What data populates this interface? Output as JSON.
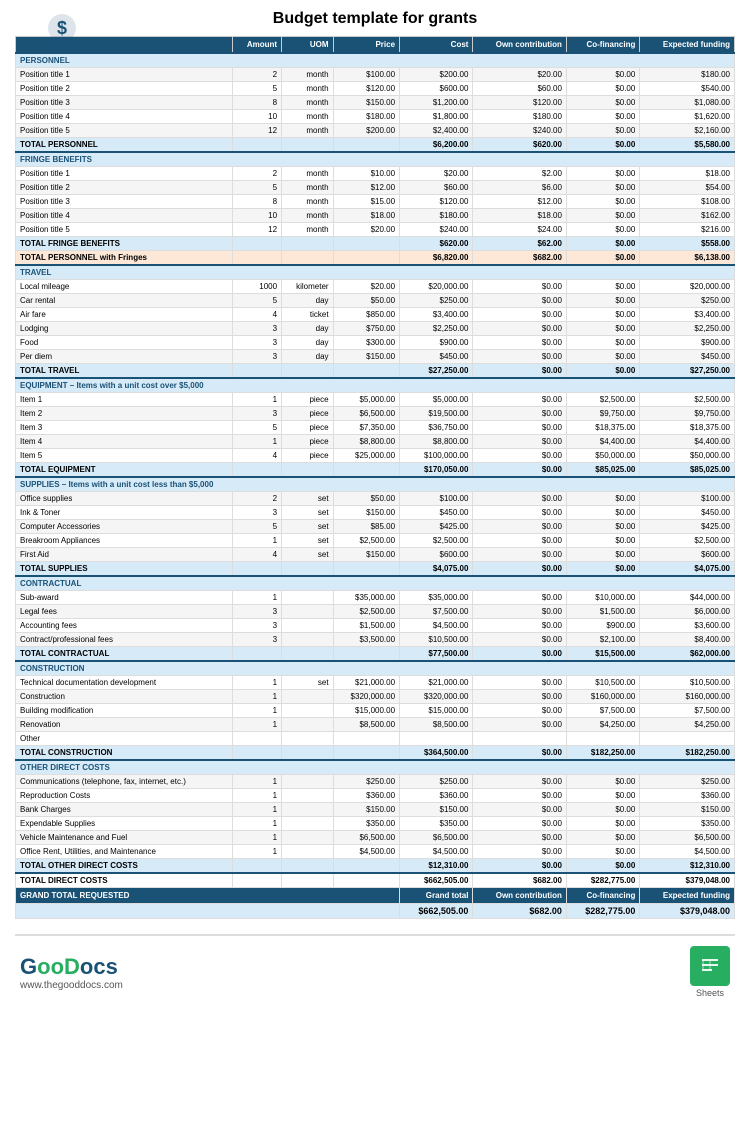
{
  "header": {
    "title": "Budget template for grants"
  },
  "columns": [
    "Amount",
    "UOM",
    "Price",
    "Cost",
    "Own contribution",
    "Co-financing",
    "Expected funding"
  ],
  "sections": [
    {
      "id": "personnel",
      "label": "PERSONNEL",
      "rows": [
        [
          "Position title 1",
          "2",
          "month",
          "$100.00",
          "$200.00",
          "$20.00",
          "$0.00",
          "$180.00"
        ],
        [
          "Position title 2",
          "5",
          "month",
          "$120.00",
          "$600.00",
          "$60.00",
          "$0.00",
          "$540.00"
        ],
        [
          "Position title 3",
          "8",
          "month",
          "$150.00",
          "$1,200.00",
          "$120.00",
          "$0.00",
          "$1,080.00"
        ],
        [
          "Position title 4",
          "10",
          "month",
          "$180.00",
          "$1,800.00",
          "$180.00",
          "$0.00",
          "$1,620.00"
        ],
        [
          "Position title 5",
          "12",
          "month",
          "$200.00",
          "$2,400.00",
          "$240.00",
          "$0.00",
          "$2,160.00"
        ]
      ],
      "total": [
        "TOTAL PERSONNEL",
        "",
        "",
        "",
        "$6,200.00",
        "$620.00",
        "$0.00",
        "$5,580.00"
      ],
      "totalStyle": "total-row"
    },
    {
      "id": "fringe",
      "label": "FRINGE BENEFITS",
      "rows": [
        [
          "Position title 1",
          "2",
          "month",
          "$10.00",
          "$20.00",
          "$2.00",
          "$0.00",
          "$18.00"
        ],
        [
          "Position title 2",
          "5",
          "month",
          "$12.00",
          "$60.00",
          "$6.00",
          "$0.00",
          "$54.00"
        ],
        [
          "Position title 3",
          "8",
          "month",
          "$15.00",
          "$120.00",
          "$12.00",
          "$0.00",
          "$108.00"
        ],
        [
          "Position title 4",
          "10",
          "month",
          "$18.00",
          "$180.00",
          "$18.00",
          "$0.00",
          "$162.00"
        ],
        [
          "Position title 5",
          "12",
          "month",
          "$20.00",
          "$240.00",
          "$24.00",
          "$0.00",
          "$216.00"
        ]
      ],
      "total": [
        "TOTAL FRINGE BENEFITS",
        "",
        "",
        "",
        "$620.00",
        "$62.00",
        "$0.00",
        "$558.00"
      ],
      "totalStyle": "total-row"
    }
  ],
  "personnel_with_fringes": {
    "label": "TOTAL PERSONNEL with Fringes",
    "cost": "$6,820.00",
    "own": "$682.00",
    "cofinancing": "$0.00",
    "expected": "$6,138.00"
  },
  "travel": {
    "label": "TRAVEL",
    "rows": [
      [
        "Local mileage",
        "1000",
        "kilometer",
        "$20.00",
        "$20,000.00",
        "$0.00",
        "$0.00",
        "$20,000.00"
      ],
      [
        "Car rental",
        "5",
        "day",
        "$50.00",
        "$250.00",
        "$0.00",
        "$0.00",
        "$250.00"
      ],
      [
        "Air fare",
        "4",
        "ticket",
        "$850.00",
        "$3,400.00",
        "$0.00",
        "$0.00",
        "$3,400.00"
      ],
      [
        "Lodging",
        "3",
        "day",
        "$750.00",
        "$2,250.00",
        "$0.00",
        "$0.00",
        "$2,250.00"
      ],
      [
        "Food",
        "3",
        "day",
        "$300.00",
        "$900.00",
        "$0.00",
        "$0.00",
        "$900.00"
      ],
      [
        "Per diem",
        "3",
        "day",
        "$150.00",
        "$450.00",
        "$0.00",
        "$0.00",
        "$450.00"
      ]
    ],
    "total": [
      "TOTAL TRAVEL",
      "",
      "",
      "",
      "$27,250.00",
      "$0.00",
      "$0.00",
      "$27,250.00"
    ]
  },
  "equipment": {
    "label": "EQUIPMENT – Items with a unit cost over $5,000",
    "rows": [
      [
        "Item 1",
        "1",
        "piece",
        "$5,000.00",
        "$5,000.00",
        "$0.00",
        "$2,500.00",
        "$2,500.00"
      ],
      [
        "Item 2",
        "3",
        "piece",
        "$6,500.00",
        "$19,500.00",
        "$0.00",
        "$9,750.00",
        "$9,750.00"
      ],
      [
        "Item 3",
        "5",
        "piece",
        "$7,350.00",
        "$36,750.00",
        "$0.00",
        "$18,375.00",
        "$18,375.00"
      ],
      [
        "Item 4",
        "1",
        "piece",
        "$8,800.00",
        "$8,800.00",
        "$0.00",
        "$4,400.00",
        "$4,400.00"
      ],
      [
        "Item 5",
        "4",
        "piece",
        "$25,000.00",
        "$100,000.00",
        "$0.00",
        "$50,000.00",
        "$50,000.00"
      ]
    ],
    "total": [
      "TOTAL EQUIPMENT",
      "",
      "",
      "",
      "$170,050.00",
      "$0.00",
      "$85,025.00",
      "$85,025.00"
    ]
  },
  "supplies": {
    "label": "SUPPLIES – Items with a unit cost less than $5,000",
    "rows": [
      [
        "Office supplies",
        "2",
        "set",
        "$50.00",
        "$100.00",
        "$0.00",
        "$0.00",
        "$100.00"
      ],
      [
        "Ink & Toner",
        "3",
        "set",
        "$150.00",
        "$450.00",
        "$0.00",
        "$0.00",
        "$450.00"
      ],
      [
        "Computer Accessories",
        "5",
        "set",
        "$85.00",
        "$425.00",
        "$0.00",
        "$0.00",
        "$425.00"
      ],
      [
        "Breakroom Appliances",
        "1",
        "set",
        "$2,500.00",
        "$2,500.00",
        "$0.00",
        "$0.00",
        "$2,500.00"
      ],
      [
        "First Aid",
        "4",
        "set",
        "$150.00",
        "$600.00",
        "$0.00",
        "$0.00",
        "$600.00"
      ]
    ],
    "total": [
      "TOTAL SUPPLIES",
      "",
      "",
      "",
      "$4,075.00",
      "$0.00",
      "$0.00",
      "$4,075.00"
    ]
  },
  "contractual": {
    "label": "CONTRACTUAL",
    "rows": [
      [
        "Sub-award",
        "1",
        "",
        "$35,000.00",
        "$35,000.00",
        "$0.00",
        "$10,000.00",
        "$44,000.00"
      ],
      [
        "Legal fees",
        "3",
        "",
        "$2,500.00",
        "$7,500.00",
        "$0.00",
        "$1,500.00",
        "$6,000.00"
      ],
      [
        "Accounting fees",
        "3",
        "",
        "$1,500.00",
        "$4,500.00",
        "$0.00",
        "$900.00",
        "$3,600.00"
      ],
      [
        "Contract/professional fees",
        "3",
        "",
        "$3,500.00",
        "$10,500.00",
        "$0.00",
        "$2,100.00",
        "$8,400.00"
      ]
    ],
    "total": [
      "TOTAL CONTRACTUAL",
      "",
      "",
      "",
      "$77,500.00",
      "$0.00",
      "$15,500.00",
      "$62,000.00"
    ]
  },
  "construction": {
    "label": "CONSTRUCTION",
    "rows": [
      [
        "Technical documentation development",
        "1",
        "set",
        "$21,000.00",
        "$21,000.00",
        "$0.00",
        "$10,500.00",
        "$10,500.00"
      ],
      [
        "Construction",
        "1",
        "",
        "$320,000.00",
        "$320,000.00",
        "$0.00",
        "$160,000.00",
        "$160,000.00"
      ],
      [
        "Building modification",
        "1",
        "",
        "$15,000.00",
        "$15,000.00",
        "$0.00",
        "$7,500.00",
        "$7,500.00"
      ],
      [
        "Renovation",
        "1",
        "",
        "$8,500.00",
        "$8,500.00",
        "$0.00",
        "$4,250.00",
        "$4,250.00"
      ],
      [
        "Other",
        "",
        "",
        "",
        "",
        "",
        "",
        ""
      ]
    ],
    "total": [
      "TOTAL CONSTRUCTION",
      "",
      "",
      "",
      "$364,500.00",
      "$0.00",
      "$182,250.00",
      "$182,250.00"
    ]
  },
  "other_direct": {
    "label": "OTHER DIRECT COSTS",
    "rows": [
      [
        "Communications (telephone, fax, internet, etc.)",
        "1",
        "",
        "$250.00",
        "$250.00",
        "$0.00",
        "$0.00",
        "$250.00"
      ],
      [
        "Reproduction Costs",
        "1",
        "",
        "$360.00",
        "$360.00",
        "$0.00",
        "$0.00",
        "$360.00"
      ],
      [
        "Bank Charges",
        "1",
        "",
        "$150.00",
        "$150.00",
        "$0.00",
        "$0.00",
        "$150.00"
      ],
      [
        "Expendable Supplies",
        "1",
        "",
        "$350.00",
        "$350.00",
        "$0.00",
        "$0.00",
        "$350.00"
      ],
      [
        "Vehicle Maintenance and Fuel",
        "1",
        "",
        "$6,500.00",
        "$6,500.00",
        "$0.00",
        "$0.00",
        "$6,500.00"
      ],
      [
        "Office Rent, Utilities, and Maintenance",
        "1",
        "",
        "$4,500.00",
        "$4,500.00",
        "$0.00",
        "$0.00",
        "$4,500.00"
      ]
    ],
    "total": [
      "TOTAL OTHER DIRECT COSTS",
      "",
      "",
      "",
      "$12,310.00",
      "$0.00",
      "$0.00",
      "$12,310.00"
    ]
  },
  "total_direct": {
    "label": "TOTAL DIRECT COSTS",
    "cost": "$662,505.00",
    "own": "$682.00",
    "cofinancing": "$282,775.00",
    "expected": "$379,048.00"
  },
  "grand_total": {
    "label": "GRAND TOTAL REQUESTED",
    "headers": [
      "Grand total",
      "Own contribution",
      "Co-financing",
      "Expected funding"
    ],
    "values": [
      "$662,505.00",
      "$682.00",
      "$282,775.00",
      "$379,048.00"
    ]
  },
  "footer": {
    "logo": "GooDocs",
    "url": "www.thegooddocs.com",
    "sheets_label": "Sheets"
  }
}
